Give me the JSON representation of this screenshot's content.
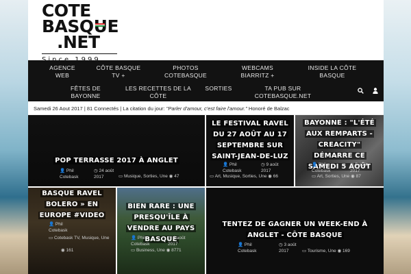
{
  "logo": {
    "line1": "COTE",
    "line2": "BASQUE",
    "line3": ".NET",
    "since": "Since 1999"
  },
  "nav": {
    "items": [
      {
        "l1": "AGENCE",
        "l2": "WEB"
      },
      {
        "l1": "CÔTE BASQUE",
        "l2": "TV +"
      },
      {
        "l1": "PHOTOS",
        "l2": "COTEBASQUE"
      },
      {
        "l1": "WEBCAMS",
        "l2": "BIARRITZ +"
      },
      {
        "l1": "INSIDE LA CÔTE",
        "l2": "BASQUE"
      },
      {
        "l1": "FÊTES DE",
        "l2": "BAYONNE"
      },
      {
        "l1": "LES RECETTES DE LA",
        "l2": "CÔTE"
      },
      {
        "l1": "SORTIES",
        "l2": ""
      },
      {
        "l1": "TA PUB SUR",
        "l2": "COTEBASQUE.NET"
      }
    ],
    "search_icon": "search-icon",
    "user_icon": "user-icon"
  },
  "infobar": {
    "date": "Samedi 26 Aout 2017",
    "connected": "| 81 Connectés |",
    "quote_label": "La citation du jour:",
    "quote": "\"Parler d'amour, c'est faire l'amour.\"",
    "author": "Honoré de Balzac"
  },
  "tiles": [
    {
      "title": "POP TERRASSE 2017 À ANGLET",
      "author": "Phil Cotebask",
      "date": "24 août 2017",
      "cats": "Musique, Sorties, Une",
      "views": "47"
    },
    {
      "title": "LE FESTIVAL RAVEL DU 27 AOÛT AU 17 SEPTEMBRE SUR SAINT-JEAN-DE-LUZ",
      "author": "Phil Cotebask",
      "date": "9 août 2017",
      "cats": "Art, Musique, Sorties, Une",
      "views": "66"
    },
    {
      "title": "BAYONNE : \"L'ÉTÉ AUX REMPARTS - CREACITY\" DÉMARRE CE SAMEDI 5 AOÛT",
      "author": "Phil Cotebask",
      "date": "5 août 2017",
      "cats": "Art, Sorties, Une",
      "views": "87"
    },
    {
      "title": "BASQUE RAVEL BOLERO » EN EUROPE #VIDEO",
      "author": "Phil Cotebask",
      "date": "",
      "cats": "Cotebask TV, Musique, Une",
      "views": "161"
    },
    {
      "title": "BIEN RARE : UNE PRESQU'ÎLE À VENDRE AU PAYS BASQUE",
      "author": "Phil Cotebask",
      "date": "4 août 2017",
      "cats": "Business, Une",
      "views": "8771"
    },
    {
      "title": "TENTEZ DE GAGNER UN WEEK-END À ANGLET - CÔTE BASQUE",
      "author": "Phil Cotebask",
      "date": "3 août 2017",
      "cats": "Tourisme, Une",
      "views": "169"
    }
  ],
  "colors": {
    "nav_bg": "#121212",
    "flag_red": "#d62828",
    "flag_green": "#1f8a3b"
  }
}
